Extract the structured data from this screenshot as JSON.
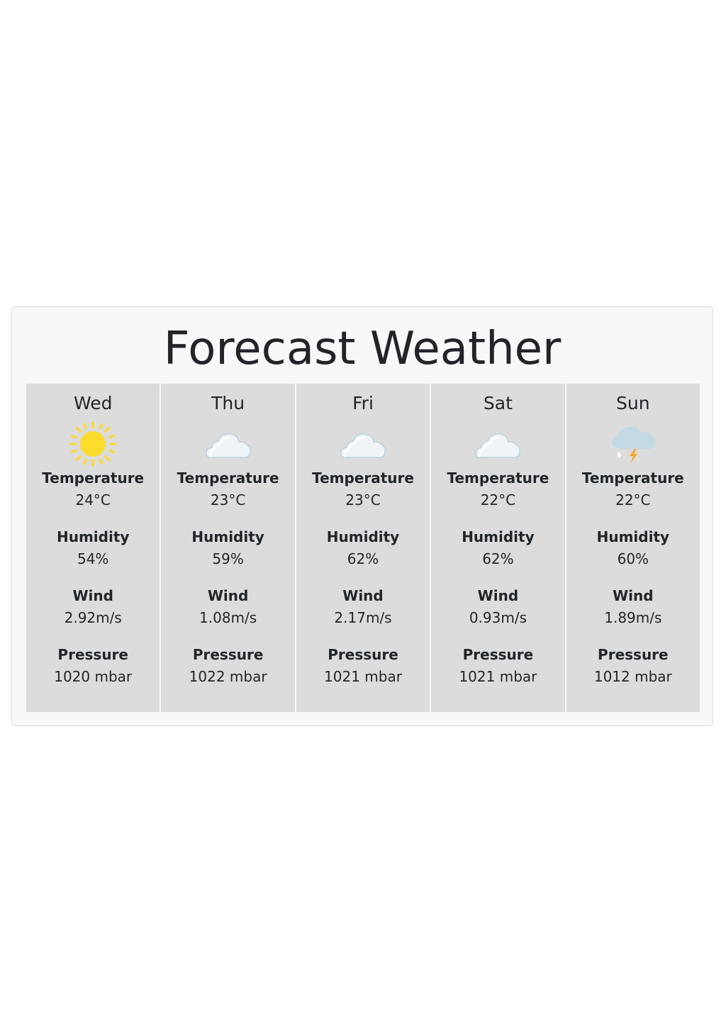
{
  "header": {
    "title": "Forecast Weather"
  },
  "labels": {
    "temperature": "Temperature",
    "humidity": "Humidity",
    "wind": "Wind",
    "pressure": "Pressure"
  },
  "days": [
    {
      "day": "Wed",
      "icon": "sun-icon",
      "temperature": "24°C",
      "humidity": "54%",
      "wind": "2.92m/s",
      "pressure": "1020 mbar"
    },
    {
      "day": "Thu",
      "icon": "cloud-icon",
      "temperature": "23°C",
      "humidity": "59%",
      "wind": "1.08m/s",
      "pressure": "1022 mbar"
    },
    {
      "day": "Fri",
      "icon": "cloud-icon",
      "temperature": "23°C",
      "humidity": "62%",
      "wind": "2.17m/s",
      "pressure": "1021 mbar"
    },
    {
      "day": "Sat",
      "icon": "cloud-icon",
      "temperature": "22°C",
      "humidity": "62%",
      "wind": "0.93m/s",
      "pressure": "1021 mbar"
    },
    {
      "day": "Sun",
      "icon": "thunderstorm-icon",
      "temperature": "22°C",
      "humidity": "60%",
      "wind": "1.89m/s",
      "pressure": "1012 mbar"
    }
  ],
  "colors": {
    "panel_background": "#f7f8fa",
    "card_background": "#dcdcdc",
    "text": "#212529",
    "sun": "#fddc2b",
    "cloud": "#f1f6fa",
    "storm_cloud": "#c3dae5",
    "lightning": "#f5a623"
  }
}
